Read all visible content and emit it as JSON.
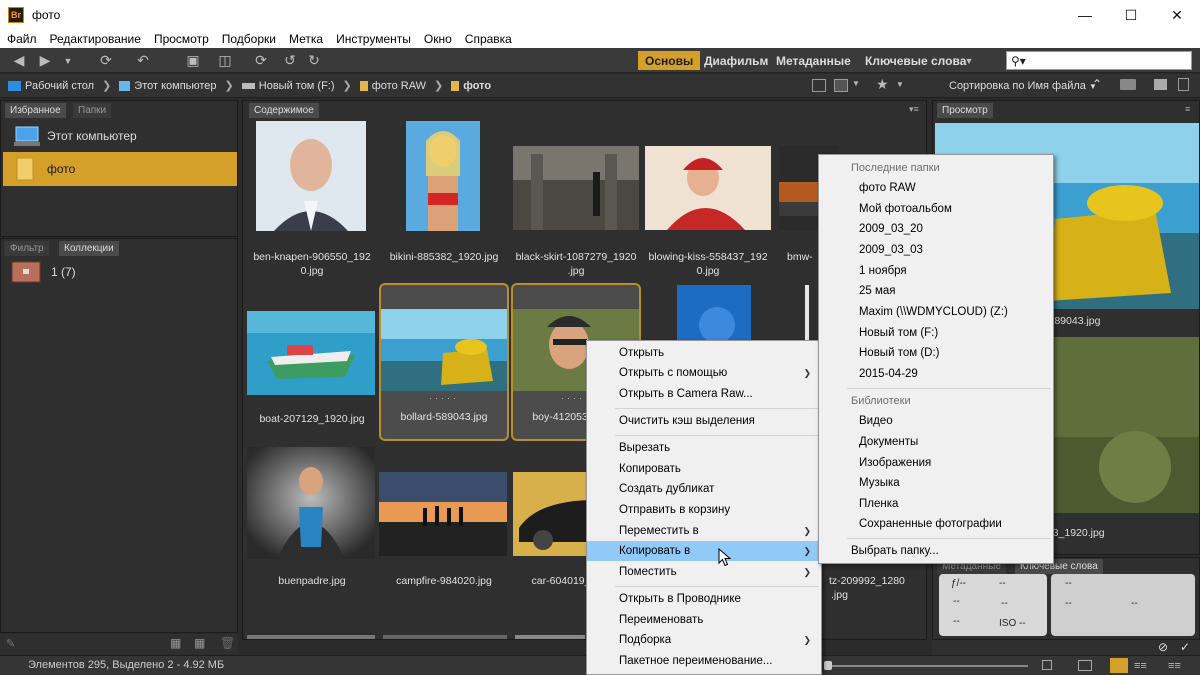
{
  "window": {
    "app_badge": "Br",
    "title": "фото"
  },
  "menubar": [
    "Файл",
    "Редактирование",
    "Просмотр",
    "Подборки",
    "Метка",
    "Инструменты",
    "Окно",
    "Справка"
  ],
  "workspace_tabs": [
    "Основы",
    "Диафильм",
    "Метаданные",
    "Ключевые слова"
  ],
  "search": {
    "value": ""
  },
  "path": [
    {
      "label": "Рабочий стол",
      "icon": "desktop-icon",
      "color": "#2a8fe0"
    },
    {
      "label": "Этот компьютер",
      "icon": "computer-icon",
      "color": "#6ab4ec"
    },
    {
      "label": "Новый том (F:)",
      "icon": "drive-icon",
      "color": "#bbbbbb"
    },
    {
      "label": "фото RAW",
      "icon": "folder-icon",
      "color": "#e4b74c"
    },
    {
      "label": "фото",
      "icon": "folder-icon",
      "color": "#e4b74c"
    }
  ],
  "sort_label": "Сортировка по Имя файла",
  "left_panel": {
    "tabs": [
      "Избранное",
      "Папки"
    ],
    "favorites": [
      {
        "label": "Этот компьютер",
        "icon": "computer-icon",
        "selected": false
      },
      {
        "label": "фото",
        "icon": "folder-icon",
        "selected": true
      }
    ],
    "bottom_tabs": [
      "Фильтр",
      "Коллекции"
    ],
    "collections": [
      {
        "label": "1 (7)",
        "icon": "collection-icon"
      }
    ]
  },
  "content": {
    "tab": "Содержимое",
    "thumbs": [
      {
        "name": "ben-knapen-906550_1920.jpg",
        "line1": "ben-knapen-906550_192",
        "line2": "0.jpg",
        "colors": [
          "#dde7ee",
          "#9fb2c4"
        ],
        "selected": false
      },
      {
        "name": "bikini-885382_1920.jpg",
        "line1": "bikini-885382_1920.jpg",
        "line2": "",
        "colors": [
          "#59a7df",
          "#d68a4a"
        ],
        "selected": false
      },
      {
        "name": "black-skirt-1087279_1920.jpg",
        "line1": "black-skirt-1087279_1920",
        "line2": ".jpg",
        "colors": [
          "#6e6a63",
          "#3f3c38"
        ],
        "selected": false
      },
      {
        "name": "blowing-kiss-558437_1920.jpg",
        "line1": "blowing-kiss-558437_192",
        "line2": "0.jpg",
        "colors": [
          "#efe1d2",
          "#c62727"
        ],
        "selected": false
      },
      {
        "name": "bmw",
        "line1": "bmw-",
        "line2": "",
        "colors": [
          "#2b2b2b",
          "#b45a1e"
        ],
        "selected": false
      },
      {
        "name": "boat-207129_1920.jpg",
        "line1": "boat-207129_1920.jpg",
        "line2": "",
        "colors": [
          "#35a0c8",
          "#1e6b86"
        ],
        "selected": false
      },
      {
        "name": "bollard-589043.jpg",
        "line1": "bollard-589043.jpg",
        "line2": "",
        "colors": [
          "#3b9fcf",
          "#d6b218"
        ],
        "selected": true
      },
      {
        "name": "boy-412053",
        "line1": "boy-412053_",
        "line2": "",
        "colors": [
          "#6b7b43",
          "#3b3a2c"
        ],
        "selected": true
      },
      {
        "name": "buenpadre.jpg",
        "line1": "buenpadre.jpg",
        "line2": "",
        "colors": [
          "#9b9b9b",
          "#2d2d2d"
        ],
        "selected": false
      },
      {
        "name": "campfire-984020.jpg",
        "line1": "campfire-984020.jpg",
        "line2": "",
        "colors": [
          "#3a4d6d",
          "#e89a55"
        ],
        "selected": false
      },
      {
        "name": "car-604019",
        "line1": "car-604019_",
        "line2": "",
        "colors": [
          "#d7b04c",
          "#1d1d1d"
        ],
        "selected": false
      },
      {
        "name": "tz-209992_1280.jpg",
        "line1": "tz-209992_1280",
        "line2": ".jpg",
        "colors": [
          "#2f2f2f",
          "#2f2f2f"
        ],
        "selected": false
      }
    ],
    "hidden_blue_thumb": {
      "colors": [
        "#1d6cc4",
        "#0f3f83"
      ]
    }
  },
  "preview": {
    "tab": "Просмотр",
    "caption1": "-589043.jpg",
    "caption2": "053_1920.jpg"
  },
  "metadata": {
    "tabs": [
      "Метаданные",
      "Ключевые слова"
    ],
    "fstop": "ƒ/--",
    "exp": "--",
    "a": "--",
    "b": "--",
    "c": "--",
    "iso": "ISO --",
    "d": "--",
    "e": "--",
    "f": "--"
  },
  "status": {
    "text": "Элементов 295, Выделено 2 - 4.92 МБ"
  },
  "context_menu": {
    "groups": [
      [
        {
          "label": "Открыть",
          "submenu": false
        },
        {
          "label": "Открыть с помощью",
          "submenu": true
        },
        {
          "label": "Открыть в Camera Raw...",
          "submenu": false
        }
      ],
      [
        {
          "label": "Очистить кэш выделения",
          "submenu": false
        }
      ],
      [
        {
          "label": "Вырезать",
          "submenu": false
        },
        {
          "label": "Копировать",
          "submenu": false
        },
        {
          "label": "Создать дубликат",
          "submenu": false
        },
        {
          "label": "Отправить в корзину",
          "submenu": false
        },
        {
          "label": "Переместить в",
          "submenu": true
        },
        {
          "label": "Копировать в",
          "submenu": true,
          "highlighted": true
        },
        {
          "label": "Поместить",
          "submenu": true
        }
      ],
      [
        {
          "label": "Открыть в Проводнике",
          "submenu": false
        },
        {
          "label": "Переименовать",
          "submenu": false
        },
        {
          "label": "Подборка",
          "submenu": true
        },
        {
          "label": "Пакетное переименование...",
          "submenu": false
        }
      ]
    ]
  },
  "submenu": {
    "recent_header": "Последние папки",
    "recent": [
      "фото RAW",
      "Мой фотоальбом",
      "2009_03_20",
      "2009_03_03",
      "1 ноября",
      "25 мая",
      "Maxim (\\\\WDMYCLOUD) (Z:)",
      "Новый том (F:)",
      "Новый том (D:)",
      "2015-04-29"
    ],
    "libraries_header": "Библиотеки",
    "libraries": [
      "Видео",
      "Документы",
      "Изображения",
      "Музыка",
      "Пленка",
      "Сохраненные фотографии"
    ],
    "choose": "Выбрать папку..."
  }
}
